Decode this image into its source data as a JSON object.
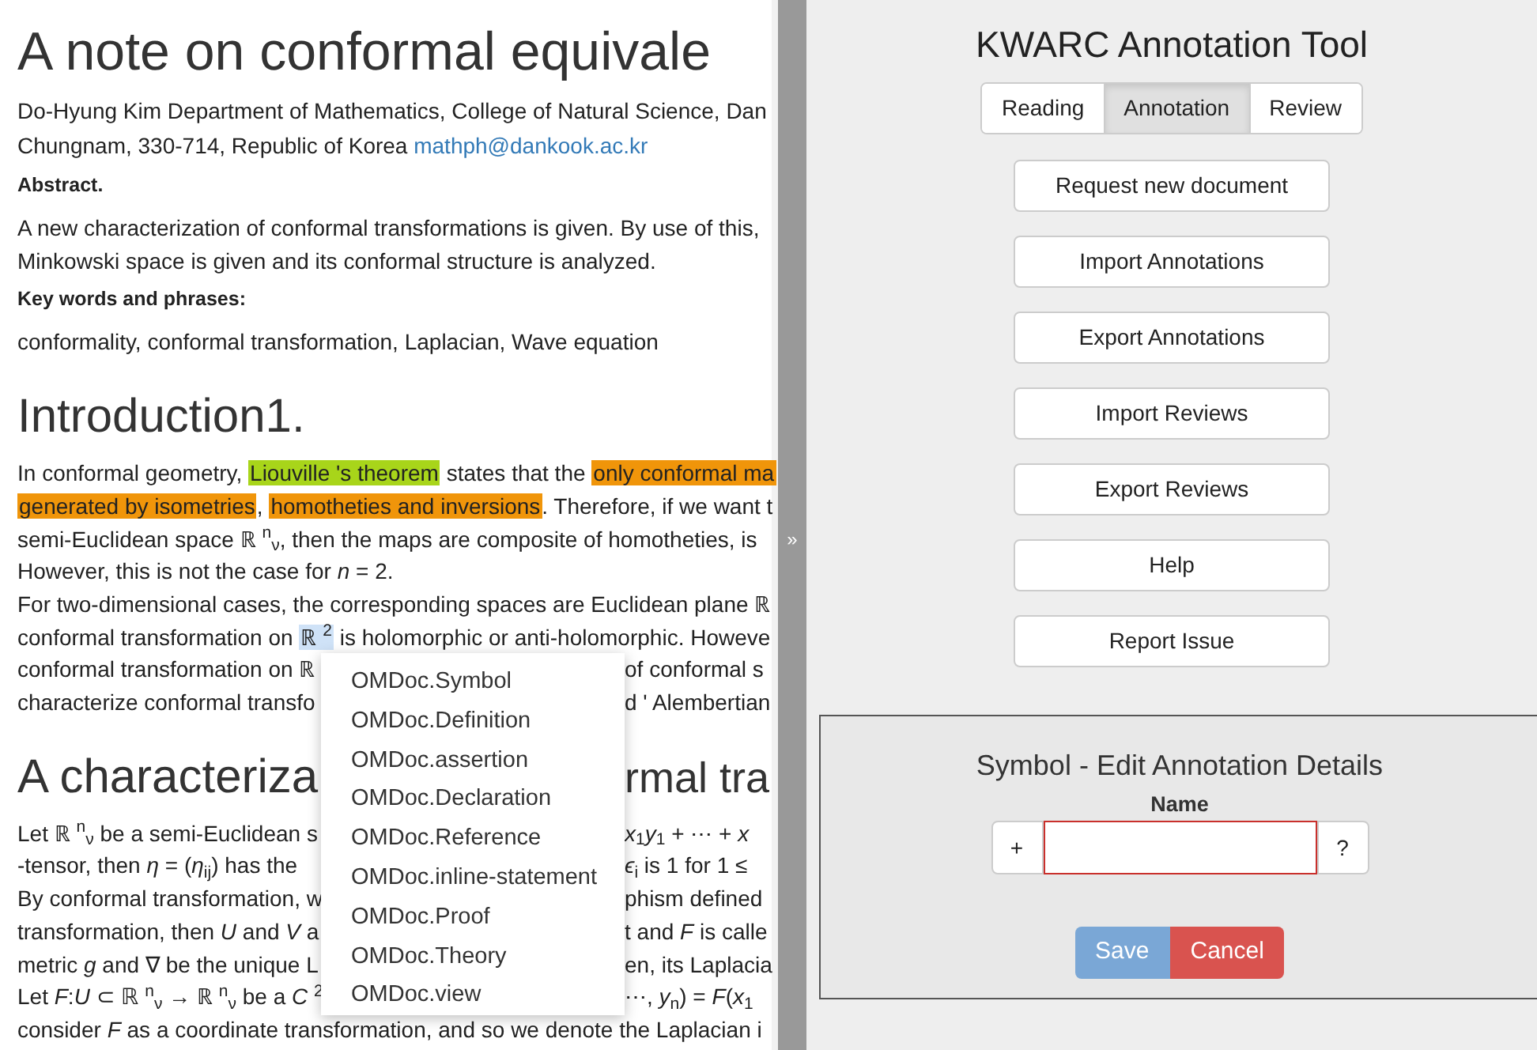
{
  "document": {
    "blocks": [
      {
        "kind": "title",
        "segments": [
          {
            "text": "A note on conformal equivale"
          }
        ]
      },
      {
        "kind": "author",
        "segments": [
          {
            "text": "Do-Hyung Kim Department of Mathematics, College of Natural Science, Dan"
          }
        ]
      },
      {
        "kind": "author",
        "segments": [
          {
            "text": "Chungnam, 330-714, Republic of Korea "
          },
          {
            "text": "mathph@dankook.ac.kr",
            "kind": "link"
          }
        ]
      },
      {
        "kind": "label",
        "segments": [
          {
            "text": "Abstract."
          }
        ]
      },
      {
        "kind": "text",
        "segments": [
          {
            "text": "A new characterization of conformal transformations is given. By use of this,"
          }
        ]
      },
      {
        "kind": "text",
        "segments": [
          {
            "text": "Minkowski space is given and its conformal structure is analyzed."
          }
        ]
      },
      {
        "kind": "label",
        "segments": [
          {
            "text": "Key words and phrases:"
          }
        ]
      },
      {
        "kind": "text",
        "segments": [
          {
            "text": "conformality, conformal transformation, Laplacian, Wave equation"
          }
        ]
      },
      {
        "kind": "heading",
        "segments": [
          {
            "text": "Introduction1."
          }
        ]
      },
      {
        "kind": "text",
        "segments": [
          {
            "text": "In conformal geometry, "
          },
          {
            "text": "Liouville 's theorem",
            "color": "#a8d51a"
          },
          {
            "text": " states that the "
          },
          {
            "text": "only conformal ma",
            "color": "#f0950a"
          }
        ]
      },
      {
        "kind": "text",
        "segments": [
          {
            "text": "generated by isometries",
            "color": "#f0950a"
          },
          {
            "text": ", "
          },
          {
            "text": "homotheties and inversions",
            "color": "#f0950a"
          },
          {
            "text": ". Therefore, if we want t"
          }
        ]
      },
      {
        "kind": "text",
        "segments": [
          {
            "text": "semi-Euclidean space ℝ $^{n}$$_{ν}$, then the maps are composite of homotheties, is"
          }
        ]
      },
      {
        "kind": "text",
        "segments": [
          {
            "text": "However, this is not the case for *n* = 2."
          }
        ]
      },
      {
        "kind": "text",
        "segments": [
          {
            "text": "For two-dimensional cases, the corresponding spaces are Euclidean plane ℝ"
          }
        ]
      },
      {
        "kind": "text",
        "segments": [
          {
            "text": "conformal transformation on "
          },
          {
            "text": "ℝ $^{2}$",
            "color": "#cfe2f7"
          },
          {
            "text": " is holomorphic or anti-holomorphic. Howeve"
          }
        ]
      },
      {
        "kind": "text",
        "segments": [
          {
            "text": "conformal transformation on ℝ"
          }
        ],
        "right": "of conformal s"
      },
      {
        "kind": "text",
        "segments": [
          {
            "text": "characterize conformal transfo"
          }
        ],
        "right": "d ' Alembertian"
      },
      {
        "kind": "heading",
        "segments": [
          {
            "text": "A characteriza"
          }
        ],
        "right": "rmal tra"
      },
      {
        "kind": "text",
        "segments": [
          {
            "text": "Let ℝ $^{n}$$_{ν}$ be a semi-Euclidean s"
          }
        ],
        "right": "*x*$_{1}$*y*$_{1}$ + ⋯ + *x*"
      },
      {
        "kind": "text",
        "segments": [
          {
            "text": "-tensor, then *η* = (*η*$_{ij}$) has the"
          }
        ],
        "right": "*ϵ*$_{i}$ is 1 for 1 ≤"
      },
      {
        "kind": "text",
        "segments": [
          {
            "text": "By conformal transformation, w"
          }
        ],
        "right": "phism defined"
      },
      {
        "kind": "text",
        "segments": [
          {
            "text": "transformation, then *U* and *V* a"
          }
        ],
        "right": "t and *F* is calle"
      },
      {
        "kind": "text",
        "segments": [
          {
            "text": "metric *g* and ∇ be the unique L"
          }
        ],
        "right": "en, its Laplacia"
      },
      {
        "kind": "text",
        "segments": [
          {
            "text": "Let *F*:*U* ⊂ ℝ $^{n}$$_{ν}$ → ℝ $^{n}$$_{ν}$ be a *C* $^{2}$"
          }
        ],
        "right": "⋯, *y*$_{n}$) = *F*(*x*$_{1}$"
      },
      {
        "kind": "text",
        "segments": [
          {
            "text": "consider *F* as a coordinate transformation, and so we denote the Laplacian i"
          }
        ]
      }
    ]
  },
  "context_menu": {
    "items": [
      "OMDoc.Symbol",
      "OMDoc.Definition",
      "OMDoc.assertion",
      "OMDoc.Declaration",
      "OMDoc.Reference",
      "OMDoc.inline-statement",
      "OMDoc.Proof",
      "OMDoc.Theory",
      "OMDoc.view"
    ]
  },
  "splitter": {
    "label": "»"
  },
  "tool": {
    "title": "KWARC Annotation Tool",
    "tabs": [
      {
        "label": "Reading",
        "selected": false
      },
      {
        "label": "Annotation",
        "selected": true
      },
      {
        "label": "Review",
        "selected": false
      }
    ],
    "buttons": [
      "Request new document",
      "Import Annotations",
      "Export Annotations",
      "Import Reviews",
      "Export Reviews",
      "Help",
      "Report Issue"
    ]
  },
  "dialog": {
    "title": "Symbol - Edit Annotation Details",
    "field_label": "Name",
    "prefix": "+",
    "suffix": "?",
    "buttons": [
      {
        "label": "Save",
        "kind": "primary"
      },
      {
        "label": "Cancel",
        "kind": "danger"
      }
    ]
  }
}
